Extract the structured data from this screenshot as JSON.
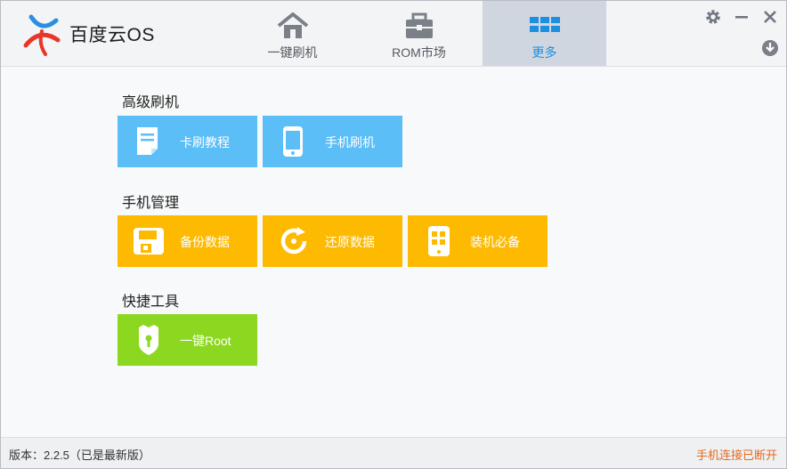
{
  "app": {
    "name": "百度云OS"
  },
  "tabs": [
    {
      "label": "一键刷机",
      "icon": "home-icon",
      "active": false
    },
    {
      "label": "ROM市场",
      "icon": "briefcase-icon",
      "active": false
    },
    {
      "label": "更多",
      "icon": "grid-icon",
      "active": true
    }
  ],
  "window_controls": [
    "gear-icon",
    "minimize-icon",
    "close-icon",
    "download-icon"
  ],
  "sections": [
    {
      "title": "高级刷机",
      "tiles": [
        {
          "label": "卡刷教程",
          "icon": "document-icon",
          "color": "#5bbef6"
        },
        {
          "label": "手机刷机",
          "icon": "phone-icon",
          "color": "#5bbef6"
        }
      ]
    },
    {
      "title": "手机管理",
      "tiles": [
        {
          "label": "备份数据",
          "icon": "floppy-disk-icon",
          "color": "#feba00"
        },
        {
          "label": "还原数据",
          "icon": "restore-icon",
          "color": "#feba00"
        },
        {
          "label": "装机必备",
          "icon": "phone-apps-icon",
          "color": "#feba00"
        }
      ]
    },
    {
      "title": "快捷工具",
      "tiles": [
        {
          "label": "一键Root",
          "icon": "shield-lock-icon",
          "color": "#8cd820"
        }
      ]
    }
  ],
  "footer": {
    "version": "版本：2.2.5（已是最新版）",
    "status": "手机连接已断开",
    "status_color": "#e8691e"
  },
  "colors": {
    "accent": "#1d8fe0",
    "blue_tile": "#5bbef6",
    "yellow_tile": "#feba00",
    "green_tile": "#8cd820"
  }
}
